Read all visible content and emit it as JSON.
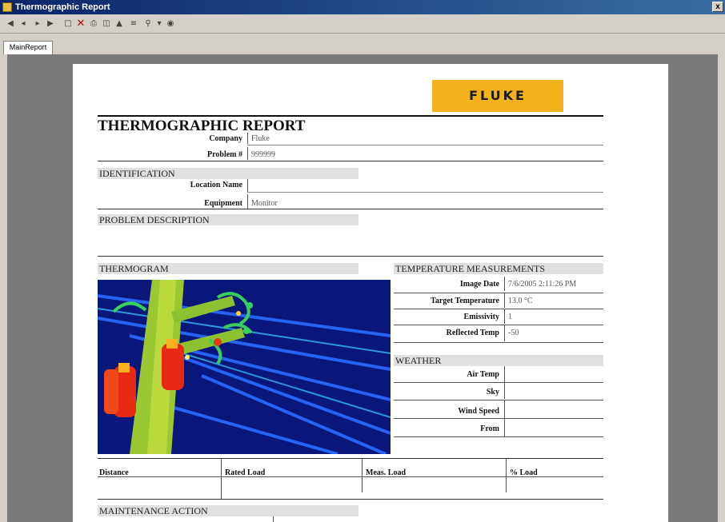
{
  "window": {
    "title": "Thermographic Report",
    "close": "x"
  },
  "toolbar": {
    "icons": [
      "first-page-icon",
      "prev-page-icon",
      "next-page-icon",
      "last-page-icon",
      "page-icon",
      "close-icon",
      "print-icon",
      "export-icon",
      "upload-icon",
      "tree-icon",
      "zoom-icon",
      "dropdown-icon",
      "find-icon"
    ]
  },
  "tabs": [
    {
      "label": "MainReport"
    }
  ],
  "report": {
    "logo": "FLUKE",
    "title": "THERMOGRAPHIC REPORT",
    "company_label": "Company",
    "company_value": "Fluke",
    "problem_label": "Problem #",
    "problem_value": "999999",
    "identification": {
      "heading": "IDENTIFICATION",
      "location_label": "Location Name",
      "location_value": "",
      "equipment_label": "Equipment",
      "equipment_value": "Monitor"
    },
    "problem_description": {
      "heading": "PROBLEM DESCRIPTION"
    },
    "thermogram": {
      "heading": "THERMOGRAM"
    },
    "temperature": {
      "heading": "TEMPERATURE MEASUREMENTS",
      "rows": [
        {
          "label": "Image Date",
          "value": "7/6/2005 2:11:26 PM"
        },
        {
          "label": "Target Temperature",
          "value": "13.0 °C"
        },
        {
          "label": "Emissivity",
          "value": "1"
        },
        {
          "label": "Reflected Temp",
          "value": "-50"
        }
      ]
    },
    "weather": {
      "heading": "WEATHER",
      "rows": [
        {
          "label": "Air Temp",
          "value": ""
        },
        {
          "label": "Sky",
          "value": ""
        },
        {
          "label": "Wind Speed",
          "value": ""
        },
        {
          "label": "From",
          "value": ""
        }
      ]
    },
    "load_table": {
      "headers": [
        "Distance",
        "Rated Load",
        "Meas. Load",
        "% Load"
      ]
    },
    "maintenance": {
      "heading": "MAINTENANCE ACTION"
    }
  }
}
